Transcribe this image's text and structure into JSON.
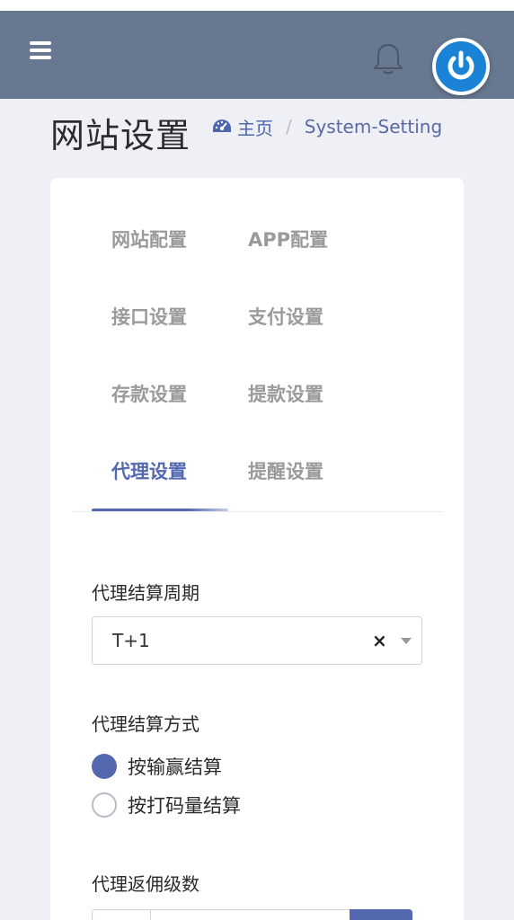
{
  "header": {
    "menu_icon": "hamburger-icon",
    "notification_icon": "bell-icon",
    "avatar_icon": "power-icon",
    "colors": {
      "bar": "#677890",
      "avatar": "#1a83d5"
    }
  },
  "page": {
    "title": "网站设置",
    "breadcrumb": {
      "home_icon": "dashboard-icon",
      "home_label": "主页",
      "separator": "/",
      "current": "System-Setting"
    }
  },
  "tabs": [
    {
      "label": "网站配置",
      "active": false
    },
    {
      "label": "APP配置",
      "active": false
    },
    {
      "label": "接口设置",
      "active": false
    },
    {
      "label": "支付设置",
      "active": false
    },
    {
      "label": "存款设置",
      "active": false
    },
    {
      "label": "提款设置",
      "active": false
    },
    {
      "label": "代理设置",
      "active": true
    },
    {
      "label": "提醒设置",
      "active": false
    }
  ],
  "form": {
    "settlement_cycle": {
      "label": "代理结算周期",
      "value": "T+1",
      "clear_glyph": "×"
    },
    "settlement_method": {
      "label": "代理结算方式",
      "options": [
        {
          "label": "按输赢结算",
          "checked": true
        },
        {
          "label": "按打码量结算",
          "checked": false
        }
      ]
    },
    "commission_levels": {
      "label": "代理返佣级数"
    }
  },
  "colors": {
    "accent": "#5468b0",
    "background": "#eef0f6"
  }
}
